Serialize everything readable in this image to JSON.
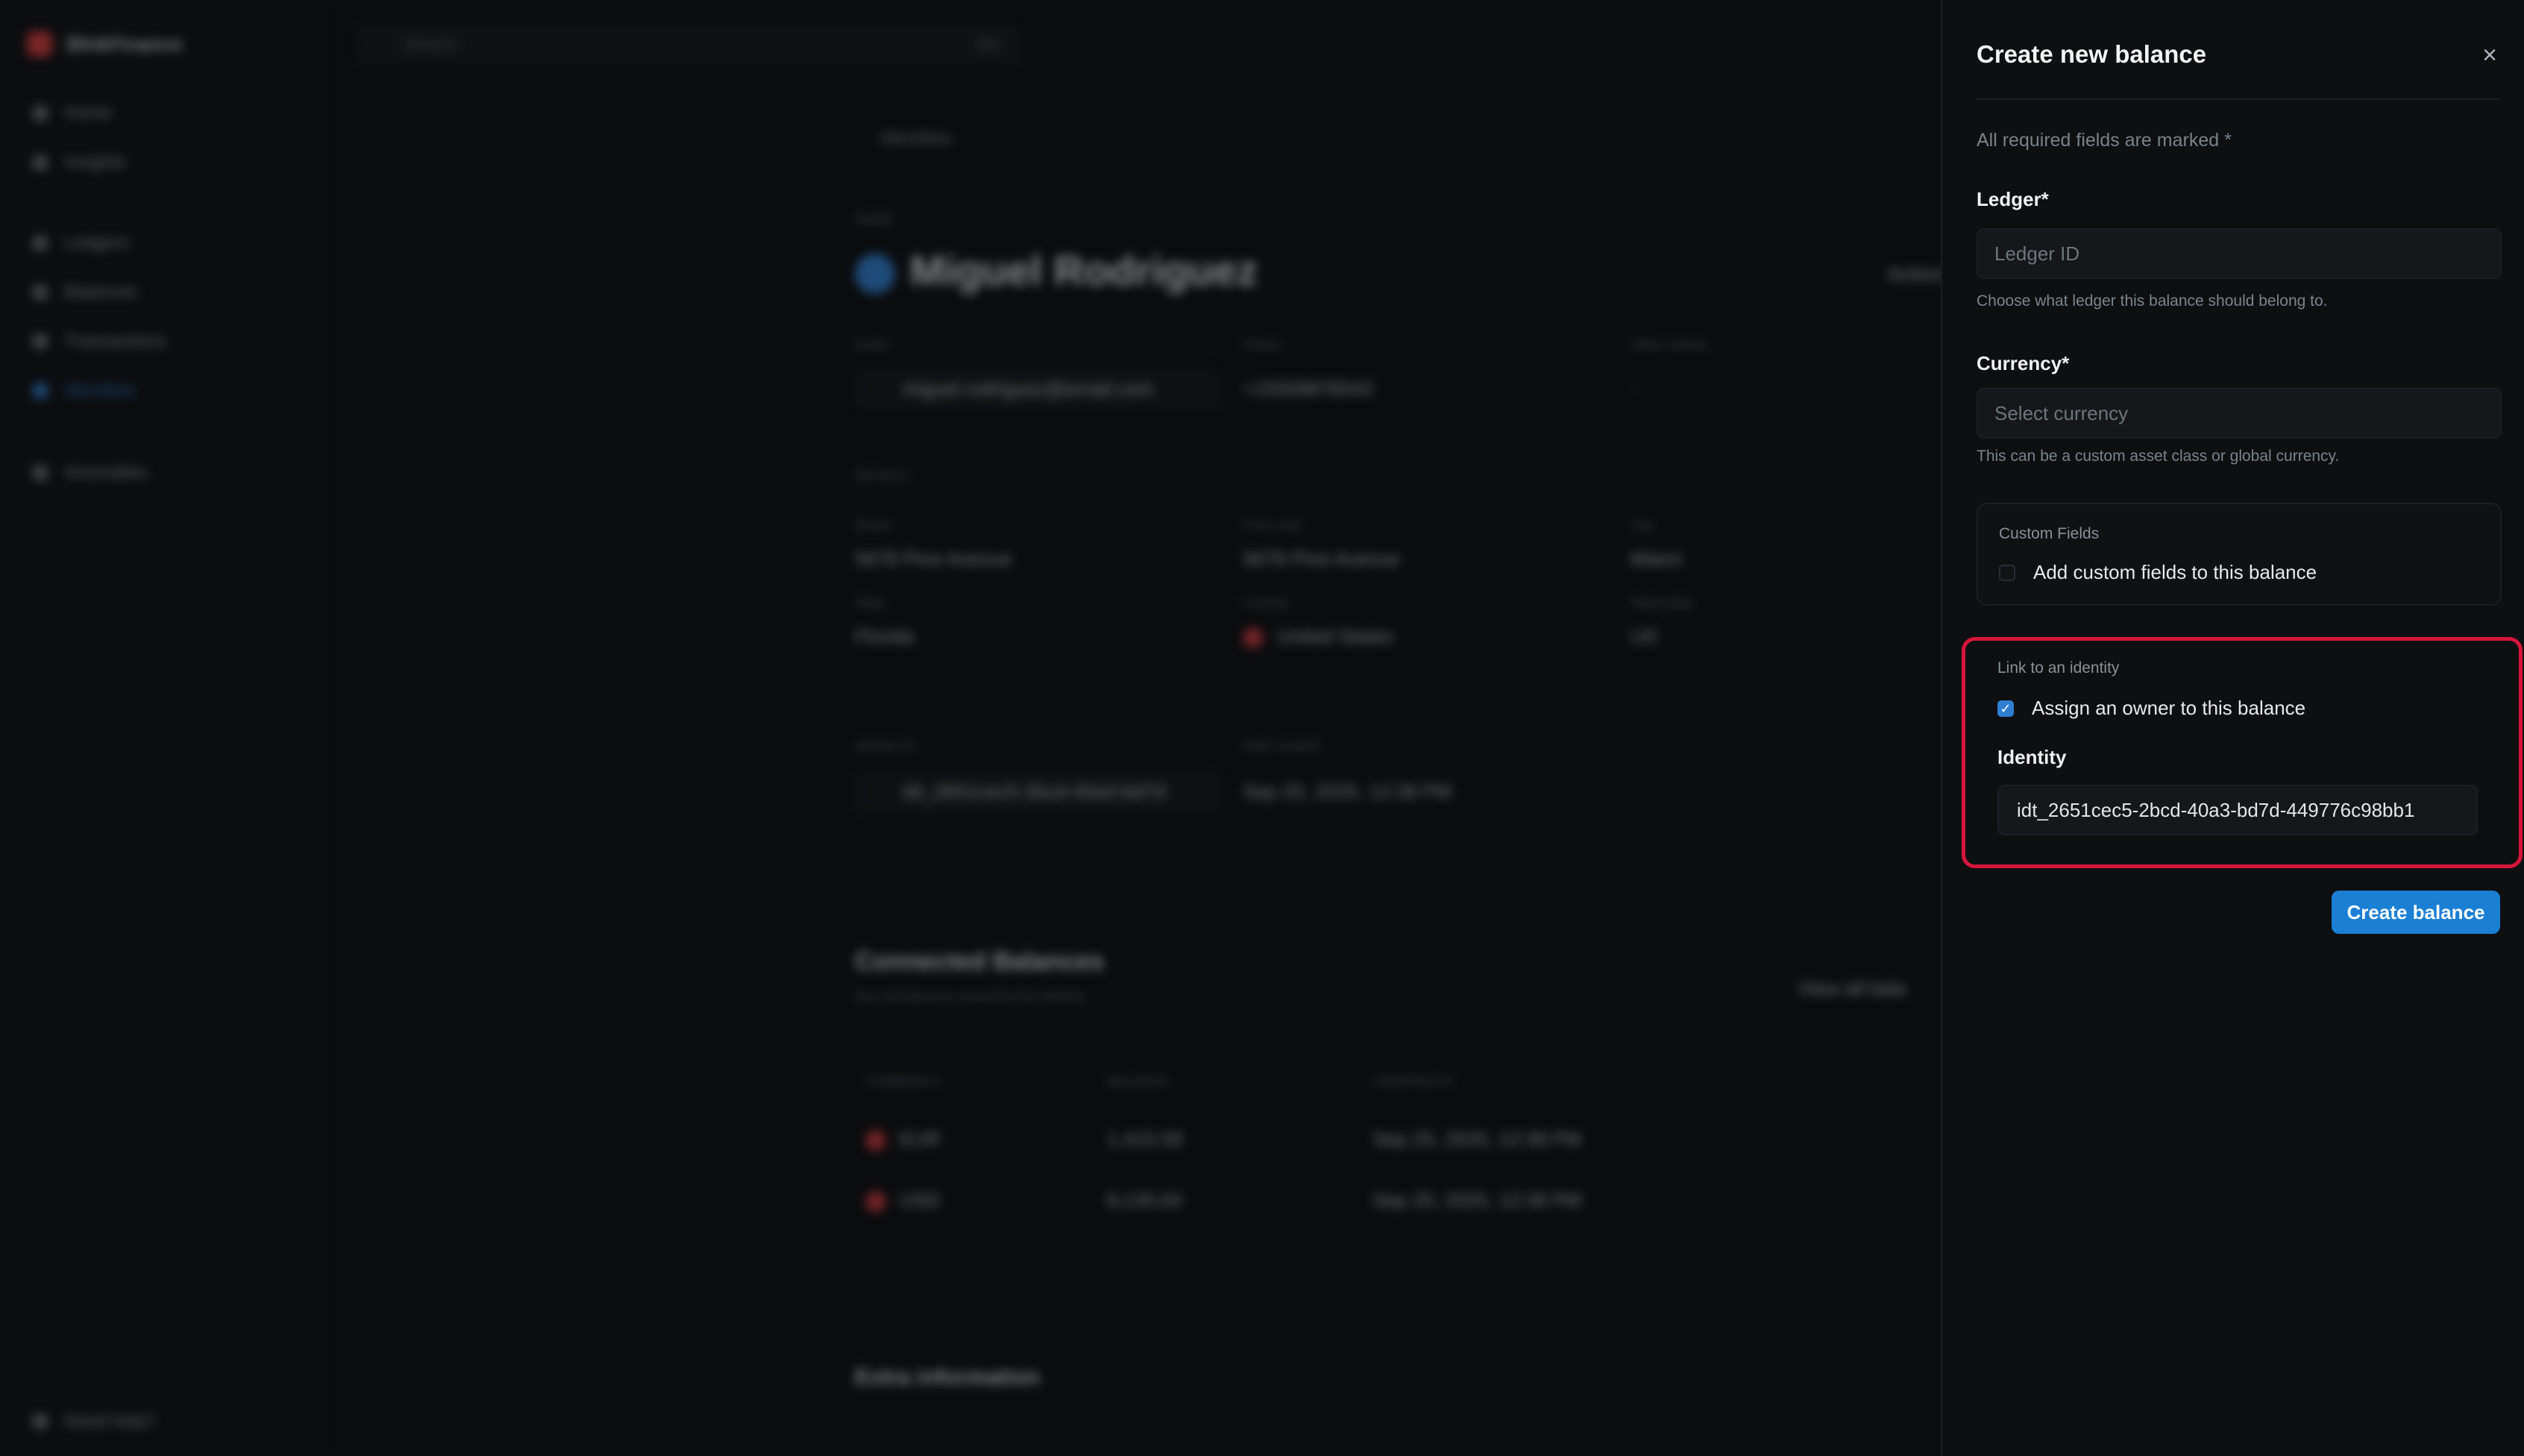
{
  "background": {
    "brand": "BlnkFinance",
    "sidebar": {
      "items": [
        {
          "label": "Home",
          "active": false
        },
        {
          "label": "Insights",
          "active": false
        },
        {
          "label": "Ledgers",
          "active": false
        },
        {
          "label": "Balances",
          "active": false
        },
        {
          "label": "Transactions",
          "active": false
        },
        {
          "label": "Identities",
          "active": true
        },
        {
          "label": "Anomalies",
          "active": false
        }
      ],
      "help": "Need help?"
    },
    "search": {
      "placeholder": "Search",
      "shortcut": "⌘K"
    },
    "breadcrumb": "Identities",
    "name_label": "NAME",
    "identity_name": "Miguel Rodriguez",
    "actions_label": "Actions",
    "fields": {
      "email_label": "Email",
      "email": "miguel.rodriguez@email.com",
      "phone_label": "Phone",
      "phone": "+15559876543",
      "other_label": "Other names",
      "other": "-",
      "details_label": "DETAILS",
      "street_label": "Street",
      "street": "5678 Pine Avenue",
      "postcode_label": "Post code",
      "postcode": "5678 Pine Avenue",
      "city_label": "City",
      "city": "Miami",
      "state_label": "State",
      "state": "Florida",
      "country_label": "Country",
      "country": "United States",
      "nationality_label": "Nationality",
      "nationality": "US",
      "identity_id_label": "Identity ID",
      "identity_id": "idt_2651cec5-2bcd-40a3-bd7d",
      "date_label": "Date created",
      "date": "Sep 25, 2025, 12:38 PM"
    },
    "connected": {
      "title": "Connected Balances",
      "subtitle": "See all balances owned by this identity",
      "view_all": "View all bala",
      "columns": [
        "CURRENCY",
        "BALANCE",
        "CREATED AT"
      ],
      "rows": [
        {
          "currency": "EUR",
          "balance": "1,415.59",
          "created": "Sep 25, 2025, 12:38 PM"
        },
        {
          "currency": "USD",
          "balance": "8,135.64",
          "created": "Sep 25, 2025, 12:38 PM"
        }
      ]
    },
    "extra_title": "Extra information"
  },
  "drawer": {
    "title": "Create new balance",
    "required_note": "All required fields are marked *",
    "ledger": {
      "label": "Ledger*",
      "placeholder": "Ledger ID",
      "hint": "Choose what ledger this balance should belong to."
    },
    "currency": {
      "label": "Currency*",
      "placeholder": "Select currency",
      "hint": "This can be a custom asset class or global currency."
    },
    "custom_fields": {
      "heading": "Custom Fields",
      "checkbox_label": "Add custom fields to this balance",
      "checked": false
    },
    "identity_link": {
      "heading": "Link to an identity",
      "checkbox_label": "Assign an owner to this balance",
      "checked": true,
      "field_label": "Identity",
      "value": "idt_2651cec5-2bcd-40a3-bd7d-449776c98bb1"
    },
    "submit_label": "Create balance",
    "highlight_color": "#d6163b",
    "accent_color": "#1b7fd4"
  }
}
